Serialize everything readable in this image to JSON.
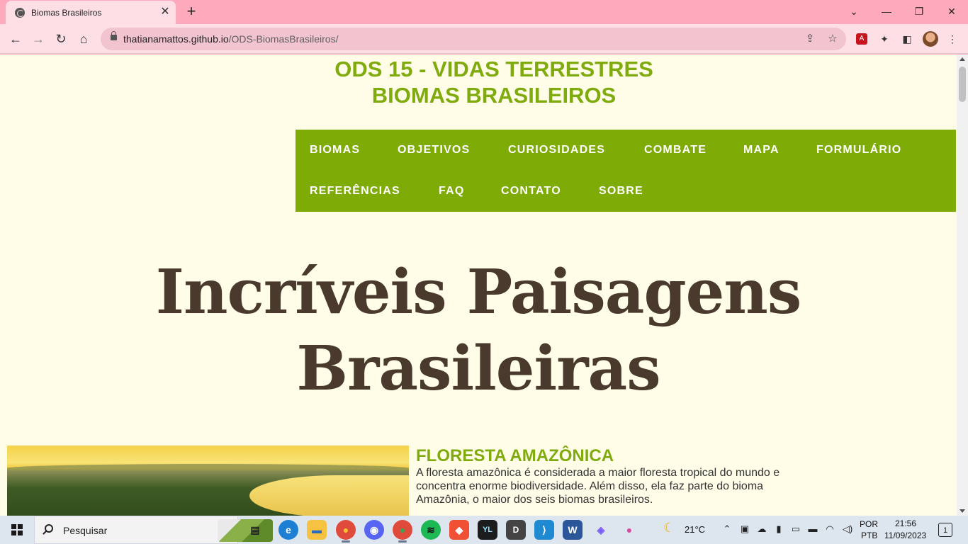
{
  "browser": {
    "tab_title": "Biomas Brasileiros",
    "tab_close": "✕",
    "new_tab": "+",
    "window_minimize": "—",
    "window_restore": "❐",
    "window_close": "✕",
    "tab_menu": "⌄",
    "url_host": "thatianamattos.github.io",
    "url_path": "/ODS-BiomasBrasileiros/",
    "back": "←",
    "forward": "→",
    "reload": "↻",
    "home": "⌂",
    "share_icon": "⇪",
    "star_icon": "☆",
    "pdf_ext": "A",
    "puzzle_icon": "✦",
    "sidepanel_icon": "◧",
    "menu_icon": "⋮"
  },
  "site": {
    "title_line1": "ODS 15 - VIDAS TERRESTRES",
    "title_line2": "BIOMAS BRASILEIROS",
    "nav": {
      "biomas": "BIOMAS",
      "objetivos": "OBJETIVOS",
      "curiosidades": "CURIOSIDADES",
      "combate": "COMBATE",
      "mapa": "MAPA",
      "formulario": "FORMULÁRIO",
      "referencias": "REFERÊNCIAS",
      "faq": "FAQ",
      "contato": "CONTATO",
      "sobre": "SOBRE"
    },
    "hero_line1": "Incríveis Paisagens",
    "hero_line2": "Brasileiras",
    "biome": {
      "title": "FLORESTA AMAZÔNICA",
      "text": "A floresta amazônica é considerada a maior floresta tropical do mundo e concentra enorme biodiversidade. Além disso, ela faz parte do bioma Amazônia, o maior dos seis biomas brasileiros."
    }
  },
  "taskbar": {
    "search_placeholder": "Pesquisar",
    "weather_temp": "21°C",
    "lang_line1": "POR",
    "lang_line2": "PTB",
    "time": "21:56",
    "date": "11/09/2023",
    "notification_count": "1",
    "apps": {
      "taskview": "▤",
      "edge": "e",
      "explorer": "▬",
      "chrome": "●",
      "discord": "◉",
      "chrome_profile": "●",
      "spotify": "≋",
      "git": "◆",
      "yl": "YL",
      "d": "D",
      "vscode": "⟩",
      "word": "W",
      "gem": "◈",
      "drop": "●"
    },
    "tray": {
      "chevron": "⌃",
      "meet": "▣",
      "cloud": "☁",
      "mic": "▮",
      "display": "▭",
      "battery": "▬",
      "wifi": "◠",
      "volume": "◁)"
    }
  }
}
